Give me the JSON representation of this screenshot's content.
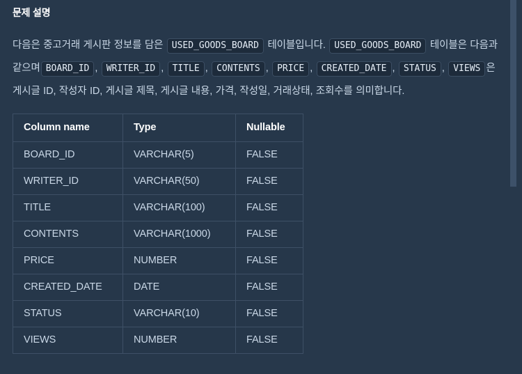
{
  "section": {
    "title": "문제 설명"
  },
  "description": {
    "line1_pre": "다음은 중고거래 게시판 정보를 담은",
    "line1_code": "USED_GOODS_BOARD",
    "line1_post": "테이블입니다.",
    "line2_code": "USED_GOODS_BOARD",
    "line2_mid": "테이블은 다음과 같으며",
    "columns_inline": [
      "BOARD_ID",
      "WRITER_ID",
      "TITLE",
      "CONTENTS",
      "PRICE",
      "CREATED_DATE",
      "STATUS",
      "VIEWS"
    ],
    "separator": ",",
    "tail": "은 게시글 ID, 작성자 ID, 게시글 제목, 게시글 내용, 가격, 작성일, 거래상태, 조회수를 의미합니다."
  },
  "table": {
    "headers": [
      "Column name",
      "Type",
      "Nullable"
    ],
    "rows": [
      {
        "name": "BOARD_ID",
        "type": "VARCHAR(5)",
        "nullable": "FALSE"
      },
      {
        "name": "WRITER_ID",
        "type": "VARCHAR(50)",
        "nullable": "FALSE"
      },
      {
        "name": "TITLE",
        "type": "VARCHAR(100)",
        "nullable": "FALSE"
      },
      {
        "name": "CONTENTS",
        "type": "VARCHAR(1000)",
        "nullable": "FALSE"
      },
      {
        "name": "PRICE",
        "type": "NUMBER",
        "nullable": "FALSE"
      },
      {
        "name": "CREATED_DATE",
        "type": "DATE",
        "nullable": "FALSE"
      },
      {
        "name": "STATUS",
        "type": "VARCHAR(10)",
        "nullable": "FALSE"
      },
      {
        "name": "VIEWS",
        "type": "NUMBER",
        "nullable": "FALSE"
      }
    ]
  },
  "colors": {
    "background": "#27384b",
    "text": "#c9d7e6",
    "heading": "#ffffff",
    "chip_bg": "#1d2b3b",
    "chip_border": "#3c4e63",
    "table_border": "#3e5066",
    "scrollbar_thumb": "#3d5169"
  }
}
